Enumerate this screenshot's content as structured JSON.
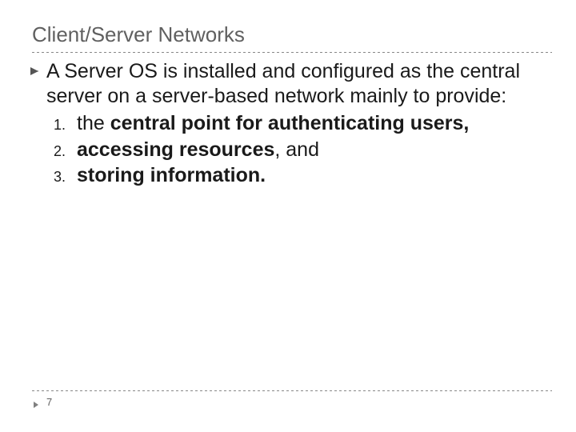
{
  "title": "Client/Server Networks",
  "intro": "A Server OS is installed and configured as the central server on a server-based network mainly to provide:",
  "items": [
    {
      "num": "1.",
      "prefix": "the ",
      "bold": "central point for authenticating users,"
    },
    {
      "num": "2.",
      "bold": "accessing resources",
      "suffix": ", and"
    },
    {
      "num": "3.",
      "bold": "storing information."
    }
  ],
  "pageNumber": "7"
}
